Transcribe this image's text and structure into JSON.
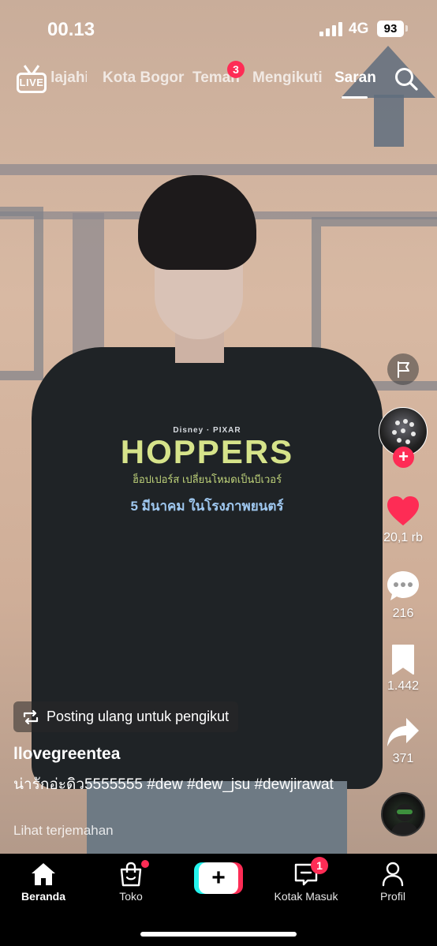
{
  "status_bar": {
    "time": "00.13",
    "network": "4G",
    "battery": "93"
  },
  "top_nav": {
    "live_label": "LIVE",
    "tabs": [
      {
        "label": "Jelajahi",
        "visible_text": "ajahi"
      },
      {
        "label": "Kota Bogor"
      },
      {
        "label": "Teman",
        "badge": "3"
      },
      {
        "label": "Mengikuti"
      },
      {
        "label": "Saran",
        "active": true
      }
    ]
  },
  "video_overlay": {
    "shirt_brand": "Disney · PIXAR",
    "shirt_title": "HOPPERS",
    "shirt_subtitle": "ฮ็อปเปอร์ส เปลี่ยนโหมดเป็นบีเวอร์",
    "shirt_date": "5 มีนาคม ในโรงภาพยนตร์"
  },
  "right_rail": {
    "likes": "20,1 rb",
    "comments": "216",
    "saves": "1.442",
    "shares": "371",
    "follow_symbol": "+"
  },
  "post": {
    "repost_label": "Posting ulang untuk pengikut",
    "username": "llovegreentea",
    "caption": "น่ารักอ่ะดิว5555555 #dew #dew_jsu #dewjirawat",
    "translate_label": "Lihat terjemahan"
  },
  "bottom_nav": {
    "items": [
      {
        "label": "Beranda",
        "active": true
      },
      {
        "label": "Toko"
      },
      {
        "label": ""
      },
      {
        "label": "Kotak Masuk",
        "badge": "1"
      },
      {
        "label": "Profil"
      }
    ],
    "create_symbol": "+"
  },
  "colors": {
    "accent": "#fe2c55",
    "cyan": "#25f4ee",
    "nav_bg": "#000000"
  }
}
